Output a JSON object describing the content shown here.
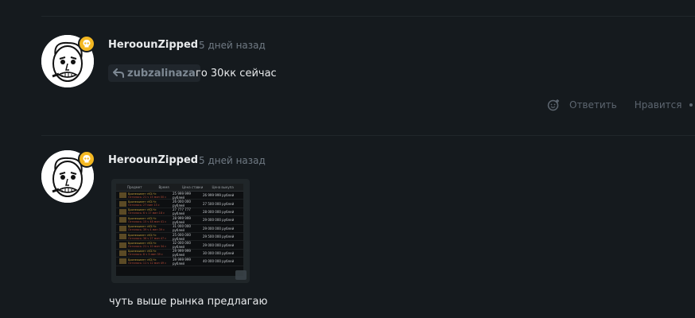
{
  "comments": [
    {
      "author": "HeroounZipped",
      "time": "5 дней назад",
      "reply_to": "zubzalinaza",
      "text": "го 30кк сейчас",
      "actions": {
        "reply": "Ответить",
        "like": "Нравится"
      }
    },
    {
      "author": "HeroounZipped",
      "time": "5 дней назад",
      "text": "чуть выше рынка предлагаю",
      "attachment": {
        "headers": [
          "Предмет",
          "Время",
          "Цена ставки",
          "Цена выкупа"
        ],
        "rows": [
          {
            "name": "Бронежилет «КЗ-Ч»",
            "time": "Осталось: 21 ч 15 мин 00 с",
            "bid": "25 999 999 рублей",
            "buy": "26 999 999 рублей"
          },
          {
            "name": "Бронежилет «КЗ-Ч»",
            "time": "Осталось: 27 мин 13 с",
            "bid": "26 000 000 рублей",
            "buy": "27 500 000 рублей"
          },
          {
            "name": "Бронежилет «КЗ-Ч»",
            "time": "Осталось: 6 ч 17 мин 18 с",
            "bid": "27 777 777 рублей",
            "buy": "28 000 000 рублей"
          },
          {
            "name": "Бронежилет «КЗ-Ч»",
            "time": "Осталось: 15 ч 48 мин 41 с",
            "bid": "28 999 999 рублей",
            "buy": "29 000 000 рублей"
          },
          {
            "name": "Бронежилет «КЗ-Ч»",
            "time": "Осталось: 39 ч 4 мин 39 с",
            "bid": "31 000 000 рублей",
            "buy": "29 000 000 рублей"
          },
          {
            "name": "Бронежилет «КЗ-Ч»",
            "time": "Осталось: 36 ч 27 мин 47 с",
            "bid": "25 000 000 рублей",
            "buy": "29 500 000 рублей"
          },
          {
            "name": "Бронежилет «КЗ-Ч»",
            "time": "Осталось: 21 ч 10 мин 34 с",
            "bid": "32 000 000 рублей",
            "buy": "29 000 000 рублей"
          },
          {
            "name": "Бронежилет «КЗ-Ч»",
            "time": "Осталось: 8 ч 3 мин 39 с",
            "bid": "29 999 999 рублей",
            "buy": "30 000 000 рублей"
          },
          {
            "name": "Бронежилет «КЗ-Ч»",
            "time": "Осталось: 11 ч 12 мин 49 с",
            "bid": "39 999 999 рублей",
            "buy": "40 000 000 рублей"
          }
        ]
      }
    }
  ],
  "icons": {
    "badge": "skull-icon",
    "reply_chip": "reply-arrow-icon",
    "emoji": "emoji-add-icon",
    "expand": "expand-image-icon"
  },
  "colors": {
    "background": "#151a1e",
    "badge": "#f4b822",
    "muted": "#707a84"
  }
}
